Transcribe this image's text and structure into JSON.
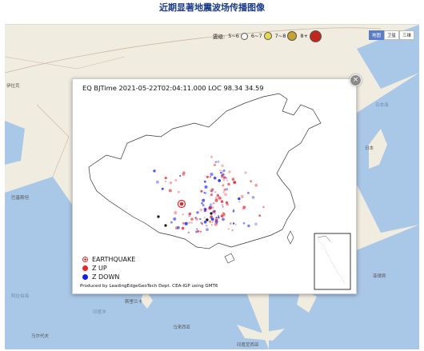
{
  "page": {
    "title": "近期显著地震波场传播图像"
  },
  "legend": {
    "label": "震级:",
    "items": [
      {
        "label": "5~6",
        "color": "#ffffff"
      },
      {
        "label": "6~7",
        "color": "#e8d84a"
      },
      {
        "label": "7~8",
        "color": "#c9a12b"
      },
      {
        "label": "8+",
        "color": "#c0281e"
      }
    ]
  },
  "map_type": {
    "buttons": [
      "地图",
      "卫星",
      "三维"
    ],
    "active": "地图"
  },
  "map_labels": [
    "伊拉克",
    "巴基斯坦",
    "阿拉伯海",
    "印度洋",
    "斯里兰卡",
    "马尔代夫",
    "马来西亚",
    "印度尼西亚",
    "日本",
    "菲律宾",
    "日本海"
  ],
  "popup": {
    "header": "EQ BJTime 2021-05-22T02:04:11.000 LOC 98.34 34.59",
    "close_glyph": "×",
    "legend": [
      {
        "label": "EARTHQUAKE",
        "color": "#e8262a"
      },
      {
        "label": "Z UP",
        "color": "#e8262a"
      },
      {
        "label": "Z DOWN",
        "color": "#1c1ee0"
      }
    ],
    "credit": "Produced by LeadingEdgeGeoTech Dept. CEA-IGP using GMT6"
  },
  "colors": {
    "up": "#e8262a",
    "down": "#1c1ee0",
    "title": "#1a3a8a"
  }
}
